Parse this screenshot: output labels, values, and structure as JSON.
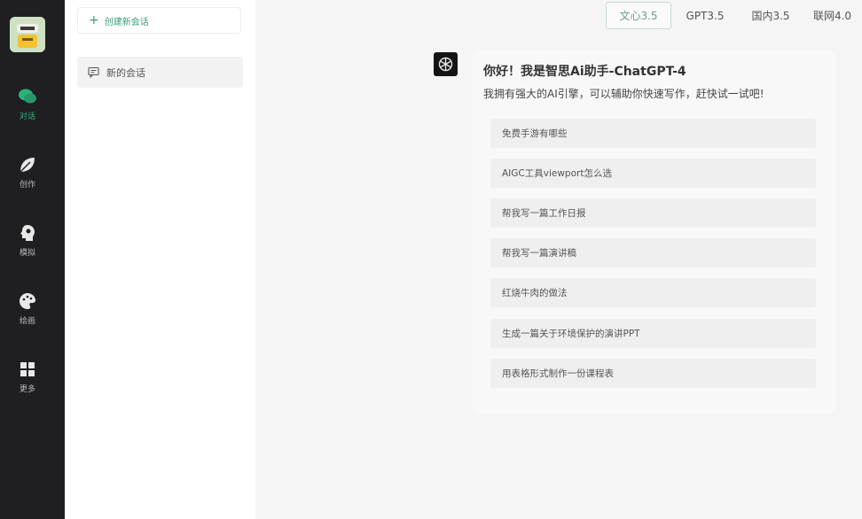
{
  "rail": {
    "items": [
      {
        "label": "对话",
        "icon": "chat-bubbles-icon"
      },
      {
        "label": "创作",
        "icon": "leaf-icon"
      },
      {
        "label": "模拟",
        "icon": "head-icon"
      },
      {
        "label": "绘画",
        "icon": "palette-icon"
      },
      {
        "label": "更多",
        "icon": "grid-icon"
      }
    ],
    "active_color": "#2fb27a"
  },
  "panel": {
    "new_chat_label": "创建新会话",
    "conversation_label": "新的会话"
  },
  "tabs": {
    "items": [
      {
        "label": "文心3.5"
      },
      {
        "label": "GPT3.5"
      },
      {
        "label": "国内3.5"
      },
      {
        "label": "联网4.0"
      }
    ],
    "active_index": 0
  },
  "chat": {
    "title": "你好！我是智思Ai助手-ChatGPT-4",
    "subtitle": "我拥有强大的AI引擎，可以辅助你快速写作，赶快试一试吧!",
    "suggestions": [
      {
        "label": "免费手游有哪些"
      },
      {
        "label": "AIGC工具viewport怎么选"
      },
      {
        "label": "帮我写一篇工作日报"
      },
      {
        "label": "帮我写一篇演讲稿"
      },
      {
        "label": "红烧牛肉的做法"
      },
      {
        "label": "生成一篇关于环境保护的演讲PPT"
      },
      {
        "label": "用表格形式制作一份课程表"
      }
    ]
  }
}
